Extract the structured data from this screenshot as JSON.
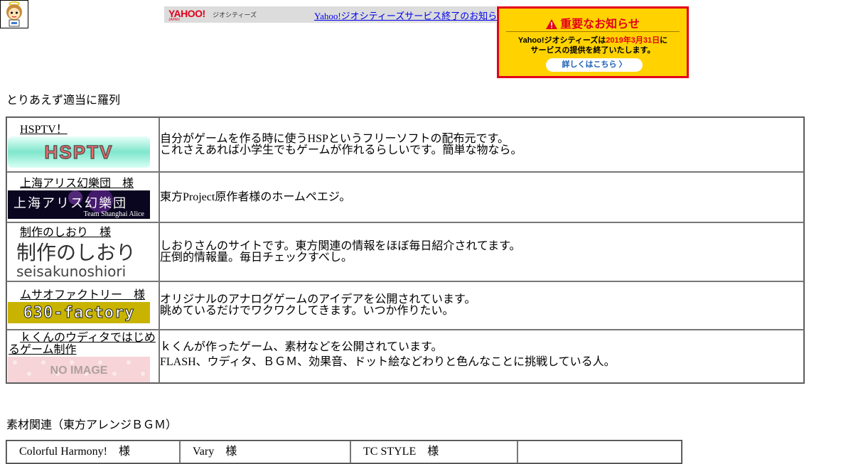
{
  "top_bar": {
    "yahoo_logo": "YAHOO!",
    "yahoo_logo_sub": "JAPAN",
    "geocities": "ジオシティーズ",
    "link": "Yahoo!ジオシティーズサービス終了のお知らせ"
  },
  "notice": {
    "title": "重要なお知らせ",
    "body_1": "Yahoo!ジオシティーズは",
    "body_date": "2019年3月31日",
    "body_2": "に",
    "body_3": "サービスの提供を終了いたします。",
    "button": "詳しくはこちら 〉",
    "accent_color": "#e2001a",
    "bg_color": "#ffd200"
  },
  "section1": {
    "heading": "とりあえず適当に羅列"
  },
  "links": [
    {
      "name": "HSPTV！",
      "banner_text": "HSPTV",
      "desc": [
        "自分がゲームを作る時に使うHSPというフリーソフトの配布元です。",
        "これさえあれば小学生でもゲームが作れるらしいです。簡単な物なら。"
      ]
    },
    {
      "name": "上海アリス幻樂団　様",
      "banner_text": "上海アリス幻樂団",
      "banner_sub": "Team Shanghai Alice",
      "desc": [
        "東方Project原作者様のホームペエジ。"
      ]
    },
    {
      "name": "制作のしおり　様",
      "banner_text": "制作のしおり",
      "banner_sub": "seisakunoshiori",
      "desc": [
        "しおりさんのサイトです。東方関連の情報をほぼ毎日紹介されてます。",
        "圧倒的情報量。毎日チェックすべし。"
      ]
    },
    {
      "name": "ムサオファクトリー　様",
      "banner_text": "630-factory",
      "desc": [
        "オリジナルのアナログゲームのアイデアを公開されています。",
        "眺めているだけでワクワクしてきます。いつか作りたい。"
      ]
    },
    {
      "name": "ｋくんのウディタではじめるゲーム制作",
      "banner_text": "NO IMAGE",
      "desc": [
        "ｋくんが作ったゲーム、素材などを公開されています。",
        "FLASH、ウディタ、ＢＧＭ、効果音、ドット絵などわりと色んなことに挑戦している人。"
      ]
    }
  ],
  "section2": {
    "heading": "素材関連（東方アレンジＢＧＭ）"
  },
  "bgm": [
    "Colorful Harmony!　様",
    "Vary　様",
    "TC STYLE　様",
    ""
  ]
}
